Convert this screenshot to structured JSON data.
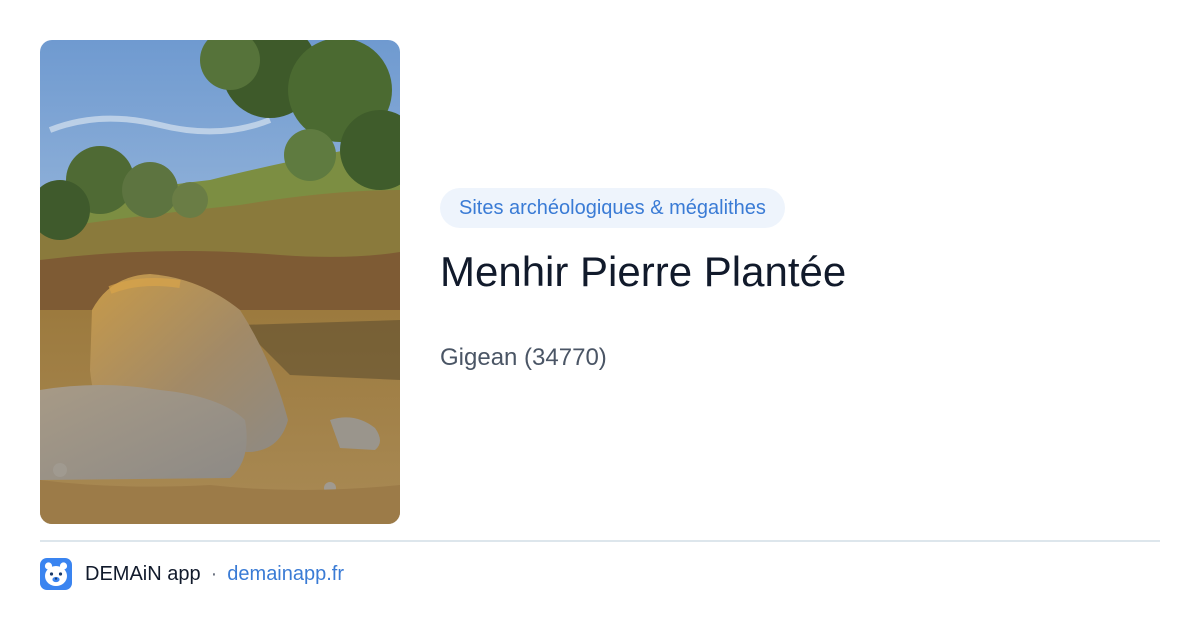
{
  "place": {
    "image_alt": "Menhir Pierre Plantée",
    "category": "Sites archéologiques & mégalithes",
    "title": "Menhir Pierre Plantée",
    "location": "Gigean (34770)"
  },
  "footer": {
    "logo_icon": "bear-face-icon",
    "app_name": "DEMAiN app",
    "separator": "·",
    "domain": "demainapp.fr"
  },
  "colors": {
    "accent": "#3a7bd5",
    "pill_background": "#eef4fc",
    "title": "#111a2b",
    "subtitle": "#4a5565",
    "divider": "#dde6ec"
  }
}
